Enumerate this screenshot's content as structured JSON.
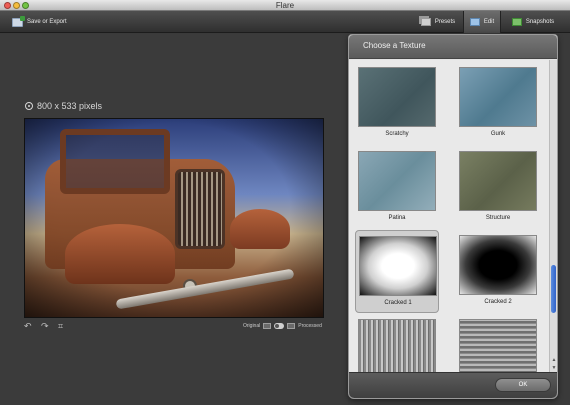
{
  "window": {
    "title": "Flare"
  },
  "toolbar": {
    "save_export": "Save or Export",
    "tabs": [
      {
        "label": "Presets",
        "icon": "presets-icon"
      },
      {
        "label": "Edit",
        "icon": "edit-icon"
      },
      {
        "label": "Snapshots",
        "icon": "snapshots-icon"
      }
    ]
  },
  "canvas": {
    "dimensions": "800 x 533 pixels",
    "compare": {
      "original_label": "Original",
      "processed_label": "Processed"
    }
  },
  "texture_panel": {
    "title": "Choose a Texture",
    "textures": [
      {
        "label": "Scratchy"
      },
      {
        "label": "Gunk"
      },
      {
        "label": "Patina"
      },
      {
        "label": "Structure"
      },
      {
        "label": "Cracked 1",
        "selected": true
      },
      {
        "label": "Cracked 2"
      },
      {
        "label": ""
      },
      {
        "label": ""
      }
    ],
    "ok_label": "OK"
  },
  "colors": {
    "selection_accent": "#2f62c9"
  }
}
